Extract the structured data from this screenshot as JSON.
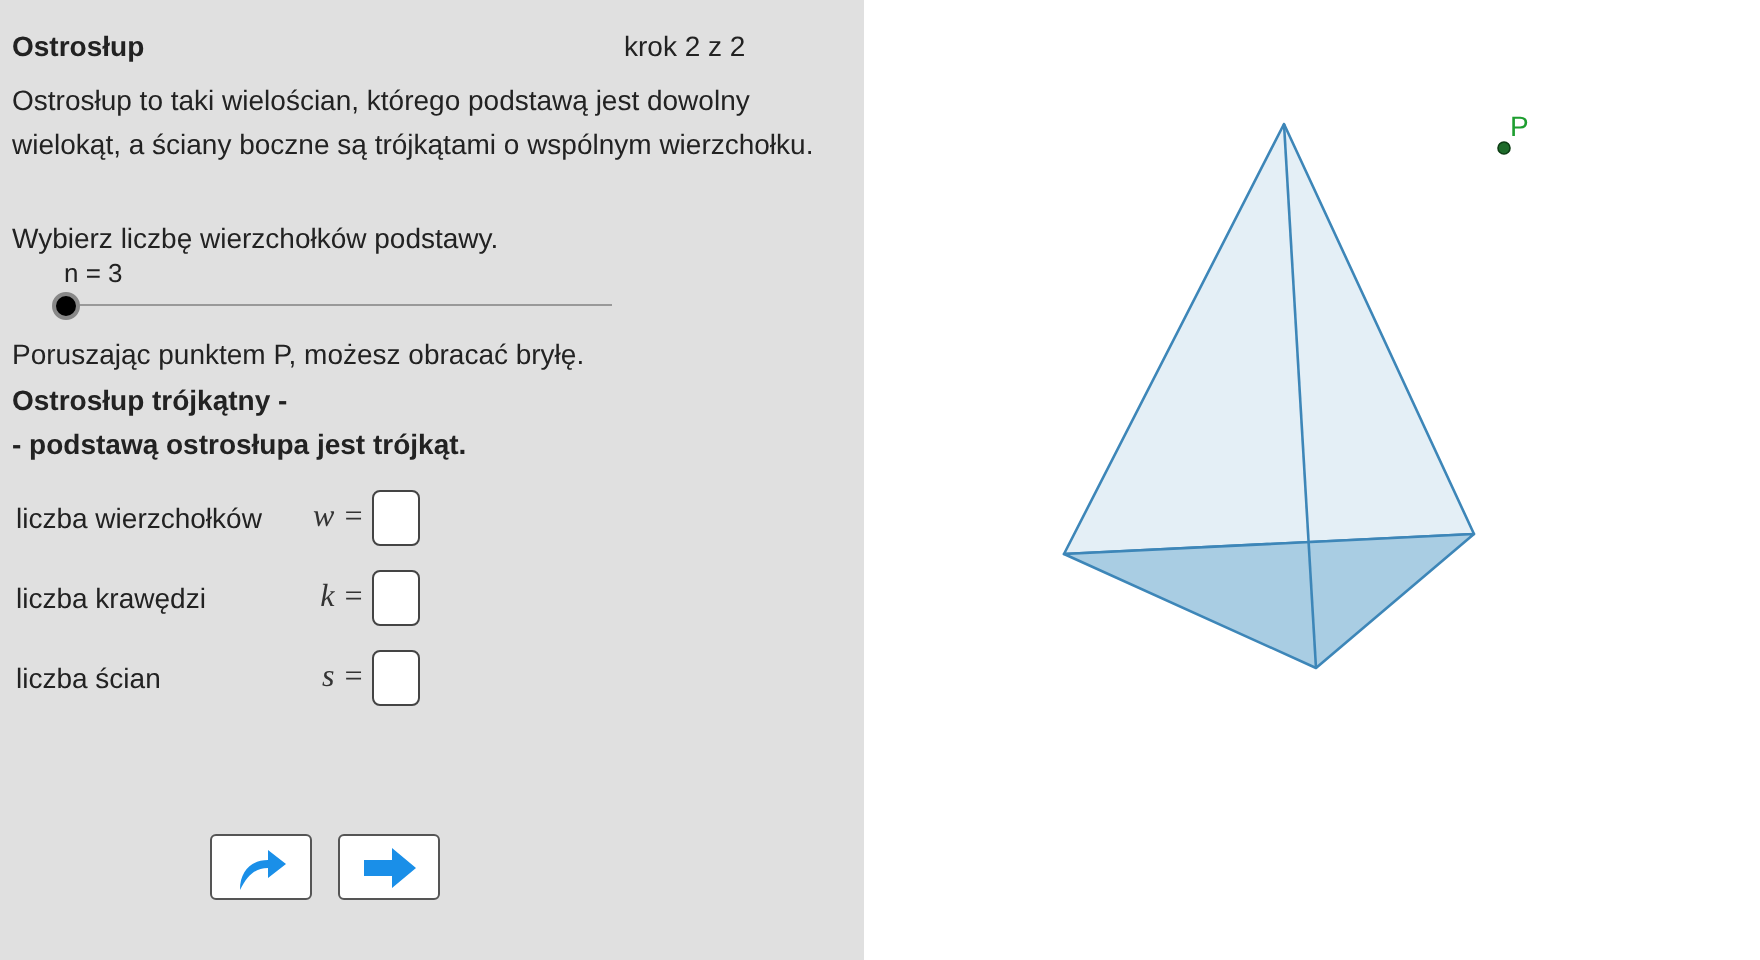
{
  "header": {
    "title": "Ostrosłup",
    "step": "krok 2 z 2"
  },
  "intro": "Ostrosłup  to taki wielościan, którego podstawą jest dowolny wielokąt, a ściany boczne są trójkątami o wspólnym wierzchołku.",
  "prompt": "Wybierz liczbę wierzchołków podstawy.",
  "slider": {
    "label": "n = 3",
    "level": 0
  },
  "hint": "Poruszając punktem P, możesz obracać bryłę.",
  "heading": [
    "Ostrosłup trójkątny -",
    "- podstawą ostrosłupa jest trójkąt."
  ],
  "answers": [
    {
      "label": "liczba wierzchołków",
      "symbol": "w ="
    },
    {
      "label": "liczba krawędzi",
      "symbol": "k ="
    },
    {
      "label": "liczba ścian",
      "symbol": "s ="
    }
  ],
  "buttons": [
    {
      "kind": "redo"
    },
    {
      "kind": "next"
    }
  ],
  "canvas": {
    "point_label": "P"
  }
}
